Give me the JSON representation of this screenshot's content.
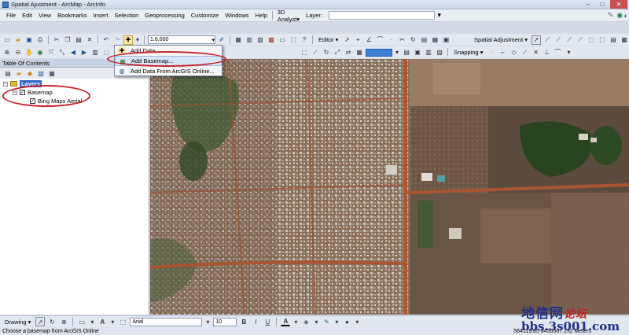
{
  "window": {
    "title": "Spatial Ajustment - ArcMap - ArcInfo",
    "minimize": "–",
    "maximize": "□",
    "close": "✕"
  },
  "menu": {
    "items": [
      "File",
      "Edit",
      "View",
      "Bookmarks",
      "Insert",
      "Selection",
      "Geoprocessing",
      "Customize",
      "Windows",
      "Help"
    ],
    "analyst_3d": "3D Analyst▾",
    "layer_label": "Layer:"
  },
  "toolbar": {
    "scale_value": "1:6,000",
    "spatial_adjustment_label": "Spatial Adjustment ▾",
    "editor_label": "Editor ▾",
    "snapping_label": "Snapping ▾"
  },
  "add_data_menu": {
    "items": [
      {
        "label": "Add Data...",
        "icon": "add-data-icon"
      },
      {
        "label": "Add Basemap...",
        "icon": "basemap-icon",
        "highlighted": true
      },
      {
        "label": "Add Data From ArcGIS Online...",
        "icon": "globe-icon"
      }
    ]
  },
  "toc": {
    "title": "Table Of Contents",
    "close": "✕",
    "layers_label": "Layers",
    "group_label": "Basemap",
    "layer_label": "Bing Maps Aerial",
    "expander_open": "−",
    "check": "✓"
  },
  "drawing": {
    "label": "Drawing ▾",
    "font_name": "Arial",
    "font_size": "10",
    "bold": "B",
    "italic": "I",
    "underline": "U",
    "font_color_letter": "A"
  },
  "status": {
    "message": "Choose a basemap from ArcGIS Online",
    "coordinates": "584119.85  8450567.292 Meters"
  },
  "watermark": {
    "chinese": "地信网",
    "chinese_accent": "论坛",
    "url": "bbs.3s001.com"
  },
  "colors": {
    "highlight_ellipse": "#c8202a",
    "layers_selected": "#3366cc",
    "watermark_blue": "#1f2f8a"
  }
}
